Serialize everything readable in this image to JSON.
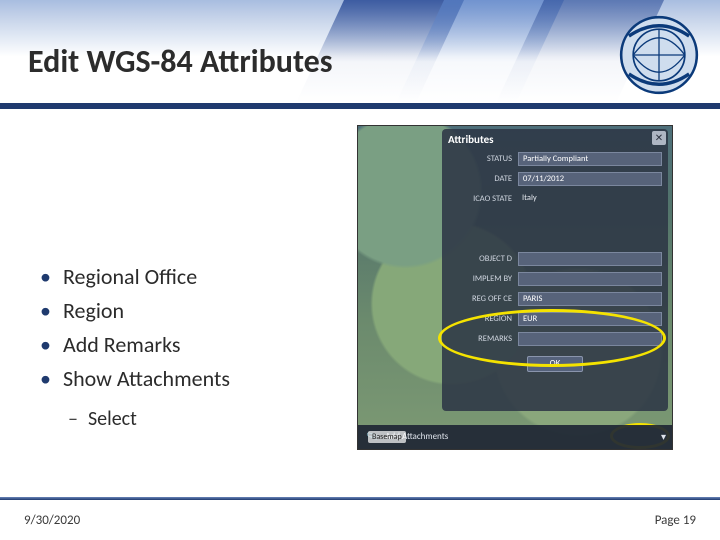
{
  "header": {
    "title": "Edit WGS-84 Attributes"
  },
  "bullets": {
    "items": [
      "Regional Office",
      "Region",
      "Add Remarks",
      "Show Attachments"
    ],
    "sub": "Select"
  },
  "panel": {
    "title": "Attributes",
    "close": "✕",
    "labels": {
      "status": "STATUS",
      "date": "DATE",
      "icao_state": "ICAO STATE",
      "object_id": "OBJECT D",
      "implem_by": "IMPLEM BY",
      "reg_office": "REG OFF CE",
      "region": "REGION",
      "remarks": "REMARKS"
    },
    "values": {
      "status": "Partially Compliant",
      "date": "07/11/2012",
      "icao_state": "Italy",
      "object_id": "",
      "implem_by": "",
      "reg_office": "PARIS",
      "region": "EUR",
      "remarks": ""
    },
    "ok": "OK"
  },
  "attachments": {
    "label": "Add Attachments"
  },
  "basemap": "Basemap",
  "footer": {
    "date": "9/30/2020",
    "page": "Page 19"
  }
}
